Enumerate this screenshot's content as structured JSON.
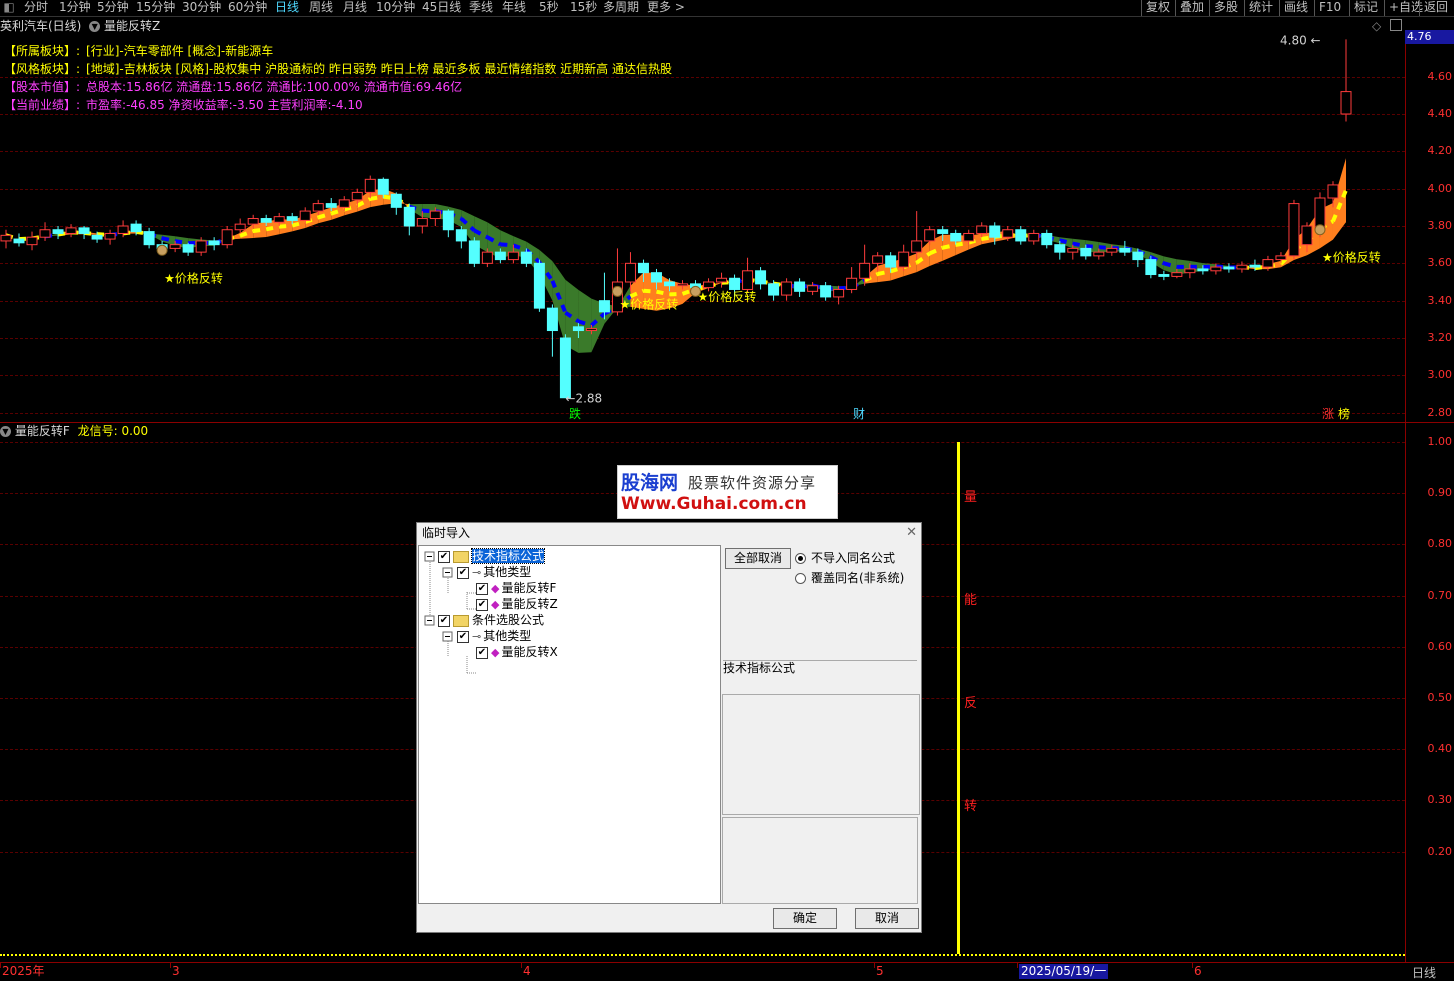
{
  "toolbar": {
    "items": [
      "分时",
      "1分钟",
      "5分钟",
      "15分钟",
      "30分钟",
      "60分钟",
      "日线",
      "周线",
      "月线",
      "10分钟",
      "45日线",
      "季线",
      "年线",
      "5秒",
      "15秒",
      "多周期",
      "更多 >"
    ],
    "active": "日线",
    "right_items": [
      "复权",
      "叠加",
      "多股",
      "统计",
      "画线",
      "F10",
      "标记",
      "+自选",
      "返回"
    ]
  },
  "main_chart": {
    "stock_title": "英利汽车(日线)",
    "indicator_title": "量能反转Z",
    "info": [
      {
        "label": "【所属板块】:",
        "value": "[行业]-汽车零部件 [概念]-新能源车",
        "color": "#ffff00"
      },
      {
        "label": "【风格板块】:",
        "value": "[地域]-吉林板块 [风格]-股权集中 沪股通标的 昨日弱势 昨日上榜 最近多板 最近情绪指数 近期新高 通达信热股",
        "color": "#ffff00"
      },
      {
        "label": "【股本市值】:",
        "value": "总股本:15.86亿 流通盘:15.86亿 流通比:100.00% 流通市值:69.46亿",
        "color": "#ff40ff"
      },
      {
        "label": "【当前业绩】:",
        "value": "市盈率:-46.85 净资收益率:-3.50 主营利润率:-4.10",
        "color": "#ff40ff"
      }
    ],
    "price_labels": {
      "high": "4.80",
      "low": "2.88",
      "current": "4.76"
    },
    "signal_text": "★价格反转",
    "event_markers": [
      "跌",
      "财",
      "涨",
      "榜"
    ],
    "y_ticks": [
      "4.60",
      "4.40",
      "4.20",
      "4.00",
      "3.80",
      "3.60",
      "3.40",
      "3.20",
      "3.00",
      "2.80"
    ]
  },
  "sub_chart": {
    "title": "量能反转F",
    "signal_label": "龙信号:",
    "signal_value": "0.00",
    "vertical_text": [
      "量",
      "能",
      "反",
      "转"
    ],
    "y_ticks": [
      "1.00",
      "0.90",
      "0.80",
      "0.70",
      "0.60",
      "0.50",
      "0.40",
      "0.30",
      "0.20"
    ]
  },
  "watermark": {
    "brand": "股海网",
    "slogan": "股票软件资源分享",
    "url": "Www.Guhai.com.cn"
  },
  "dialog": {
    "title": "临时导入",
    "tree": [
      {
        "label": "技术指标公式",
        "level": 0,
        "icon": "folder-icon",
        "selected": true
      },
      {
        "label": "其他类型",
        "level": 1,
        "icon": "key-icon"
      },
      {
        "label": "量能反转F",
        "level": 2,
        "icon": "formula-icon"
      },
      {
        "label": "量能反转Z",
        "level": 2,
        "icon": "formula-icon"
      },
      {
        "label": "条件选股公式",
        "level": 0,
        "icon": "folder-icon"
      },
      {
        "label": "其他类型",
        "level": 1,
        "icon": "key-icon"
      },
      {
        "label": "量能反转X",
        "level": 2,
        "icon": "formula-icon"
      }
    ],
    "cancel_all": "全部取消",
    "option_skip": "不导入同名公式",
    "option_overwrite": "覆盖同名(非系统)",
    "selected_type": "技术指标公式",
    "ok": "确定",
    "cancel": "取消"
  },
  "bottom_axis": {
    "dates": [
      "2025年",
      "3",
      "4",
      "5",
      "2025/05/19/一",
      "6"
    ],
    "period": "日线"
  },
  "chart_data": {
    "type": "candlestick",
    "ylim": [
      2.75,
      4.85
    ],
    "candles": [
      [
        3.72,
        3.75,
        3.68,
        3.78
      ],
      [
        3.73,
        3.71,
        3.69,
        3.76
      ],
      [
        3.7,
        3.74,
        3.67,
        3.77
      ],
      [
        3.74,
        3.78,
        3.72,
        3.82
      ],
      [
        3.78,
        3.76,
        3.73,
        3.8
      ],
      [
        3.76,
        3.79,
        3.74,
        3.81
      ],
      [
        3.79,
        3.76,
        3.73,
        3.8
      ],
      [
        3.75,
        3.73,
        3.71,
        3.77
      ],
      [
        3.73,
        3.76,
        3.7,
        3.78
      ],
      [
        3.76,
        3.8,
        3.74,
        3.83
      ],
      [
        3.81,
        3.77,
        3.75,
        3.83
      ],
      [
        3.77,
        3.7,
        3.68,
        3.79
      ],
      [
        3.7,
        3.68,
        3.65,
        3.72
      ],
      [
        3.68,
        3.7,
        3.66,
        3.72
      ],
      [
        3.7,
        3.66,
        3.64,
        3.71
      ],
      [
        3.66,
        3.72,
        3.64,
        3.74
      ],
      [
        3.72,
        3.7,
        3.67,
        3.74
      ],
      [
        3.7,
        3.78,
        3.68,
        3.8
      ],
      [
        3.78,
        3.81,
        3.76,
        3.84
      ],
      [
        3.81,
        3.84,
        3.79,
        3.86
      ],
      [
        3.84,
        3.82,
        3.8,
        3.86
      ],
      [
        3.82,
        3.85,
        3.8,
        3.87
      ],
      [
        3.85,
        3.83,
        3.81,
        3.87
      ],
      [
        3.83,
        3.88,
        3.81,
        3.9
      ],
      [
        3.88,
        3.92,
        3.86,
        3.94
      ],
      [
        3.92,
        3.9,
        3.88,
        3.95
      ],
      [
        3.9,
        3.94,
        3.88,
        3.96
      ],
      [
        3.94,
        3.98,
        3.9,
        4.0
      ],
      [
        3.98,
        4.05,
        3.95,
        4.07
      ],
      [
        4.05,
        3.97,
        3.95,
        4.06
      ],
      [
        3.97,
        3.9,
        3.86,
        3.98
      ],
      [
        3.9,
        3.8,
        3.75,
        3.92
      ],
      [
        3.8,
        3.84,
        3.76,
        3.88
      ],
      [
        3.84,
        3.88,
        3.8,
        3.9
      ],
      [
        3.88,
        3.78,
        3.74,
        3.89
      ],
      [
        3.78,
        3.72,
        3.68,
        3.8
      ],
      [
        3.72,
        3.6,
        3.58,
        3.74
      ],
      [
        3.6,
        3.66,
        3.58,
        3.68
      ],
      [
        3.66,
        3.62,
        3.6,
        3.68
      ],
      [
        3.62,
        3.66,
        3.6,
        3.7
      ],
      [
        3.66,
        3.6,
        3.58,
        3.68
      ],
      [
        3.6,
        3.36,
        3.34,
        3.62
      ],
      [
        3.36,
        3.24,
        3.1,
        3.38
      ],
      [
        3.2,
        2.88,
        2.88,
        3.22
      ],
      [
        3.26,
        3.24,
        3.2,
        3.28
      ],
      [
        3.24,
        3.25,
        3.22,
        3.27
      ],
      [
        3.4,
        3.34,
        3.3,
        3.55
      ],
      [
        3.34,
        3.5,
        3.32,
        3.68
      ],
      [
        3.5,
        3.6,
        3.45,
        3.66
      ],
      [
        3.6,
        3.55,
        3.5,
        3.62
      ],
      [
        3.55,
        3.5,
        3.46,
        3.57
      ],
      [
        3.5,
        3.48,
        3.45,
        3.52
      ],
      [
        3.48,
        3.49,
        3.46,
        3.51
      ],
      [
        3.49,
        3.47,
        3.45,
        3.51
      ],
      [
        3.47,
        3.5,
        3.45,
        3.52
      ],
      [
        3.5,
        3.52,
        3.47,
        3.55
      ],
      [
        3.52,
        3.46,
        3.42,
        3.54
      ],
      [
        3.46,
        3.56,
        3.44,
        3.63
      ],
      [
        3.56,
        3.49,
        3.46,
        3.58
      ],
      [
        3.49,
        3.43,
        3.4,
        3.51
      ],
      [
        3.43,
        3.5,
        3.4,
        3.52
      ],
      [
        3.5,
        3.45,
        3.42,
        3.52
      ],
      [
        3.45,
        3.48,
        3.43,
        3.5
      ],
      [
        3.48,
        3.42,
        3.4,
        3.5
      ],
      [
        3.42,
        3.46,
        3.38,
        3.48
      ],
      [
        3.46,
        3.52,
        3.44,
        3.58
      ],
      [
        3.52,
        3.6,
        3.48,
        3.7
      ],
      [
        3.6,
        3.64,
        3.56,
        3.66
      ],
      [
        3.64,
        3.58,
        3.55,
        3.66
      ],
      [
        3.58,
        3.66,
        3.56,
        3.7
      ],
      [
        3.66,
        3.72,
        3.62,
        3.88
      ],
      [
        3.72,
        3.78,
        3.7,
        3.8
      ],
      [
        3.78,
        3.76,
        3.72,
        3.8
      ],
      [
        3.76,
        3.72,
        3.7,
        3.78
      ],
      [
        3.72,
        3.76,
        3.7,
        3.78
      ],
      [
        3.76,
        3.8,
        3.74,
        3.82
      ],
      [
        3.8,
        3.74,
        3.7,
        3.82
      ],
      [
        3.74,
        3.78,
        3.72,
        3.8
      ],
      [
        3.78,
        3.72,
        3.7,
        3.8
      ],
      [
        3.72,
        3.76,
        3.7,
        3.78
      ],
      [
        3.76,
        3.7,
        3.68,
        3.78
      ],
      [
        3.7,
        3.66,
        3.62,
        3.72
      ],
      [
        3.66,
        3.68,
        3.62,
        3.7
      ],
      [
        3.68,
        3.64,
        3.62,
        3.7
      ],
      [
        3.64,
        3.66,
        3.62,
        3.68
      ],
      [
        3.66,
        3.68,
        3.64,
        3.7
      ],
      [
        3.68,
        3.66,
        3.64,
        3.72
      ],
      [
        3.66,
        3.62,
        3.58,
        3.68
      ],
      [
        3.62,
        3.54,
        3.52,
        3.64
      ],
      [
        3.54,
        3.53,
        3.51,
        3.56
      ],
      [
        3.53,
        3.55,
        3.52,
        3.57
      ],
      [
        3.55,
        3.57,
        3.52,
        3.6
      ],
      [
        3.57,
        3.56,
        3.54,
        3.59
      ],
      [
        3.56,
        3.58,
        3.54,
        3.6
      ],
      [
        3.58,
        3.57,
        3.55,
        3.6
      ],
      [
        3.57,
        3.59,
        3.55,
        3.61
      ],
      [
        3.59,
        3.58,
        3.56,
        3.62
      ],
      [
        3.58,
        3.62,
        3.56,
        3.64
      ],
      [
        3.62,
        3.64,
        3.6,
        3.66
      ],
      [
        3.64,
        3.92,
        3.62,
        3.94
      ],
      [
        3.7,
        3.8,
        3.66,
        3.82
      ],
      [
        3.78,
        3.95,
        3.74,
        3.98
      ],
      [
        3.95,
        4.02,
        3.9,
        4.04
      ],
      [
        4.4,
        4.52,
        4.36,
        4.8
      ]
    ]
  }
}
